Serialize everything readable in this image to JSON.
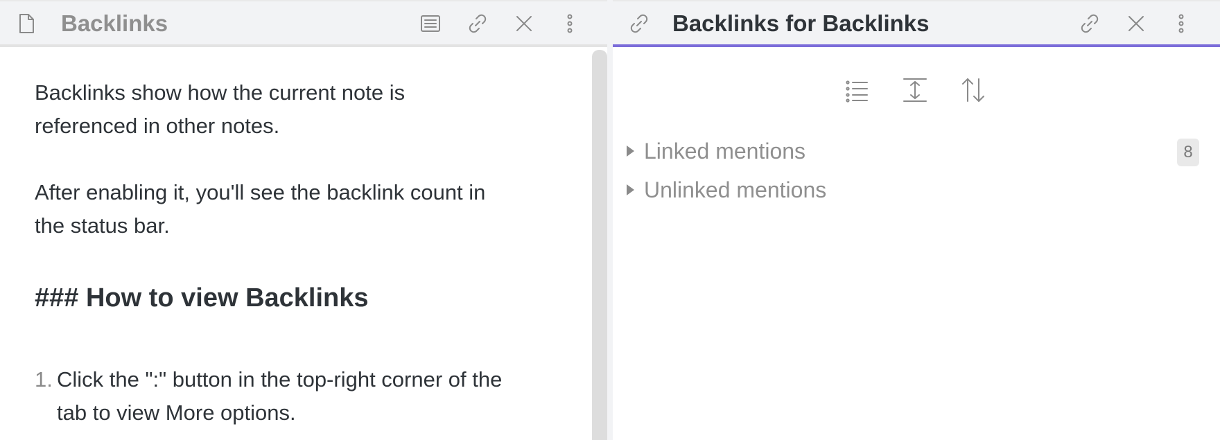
{
  "left_tab": {
    "title": "Backlinks",
    "icons": [
      "file-icon",
      "reading-view-icon",
      "link-icon",
      "close-icon",
      "more-options-icon"
    ]
  },
  "note": {
    "paragraph1": "Backlinks show how the current note is referenced in other notes.",
    "paragraph2": "After enabling it, you'll see the backlink count in the status bar.",
    "heading": "### How to view Backlinks",
    "list": [
      {
        "number": "1.",
        "text": "Click the \":\" button in the top-right corner of the tab to view More options."
      }
    ]
  },
  "right_tab": {
    "title": "Backlinks for Backlinks",
    "icons": [
      "link-icon",
      "unlink-icon",
      "close-icon",
      "more-options-icon"
    ],
    "accent_color": "#7b6cd9"
  },
  "backlinks_toolbar": {
    "icons": [
      "list-view-icon",
      "expand-icon",
      "sort-icon"
    ]
  },
  "mentions": {
    "linked_label": "Linked mentions",
    "linked_count": "8",
    "unlinked_label": "Unlinked mentions"
  }
}
